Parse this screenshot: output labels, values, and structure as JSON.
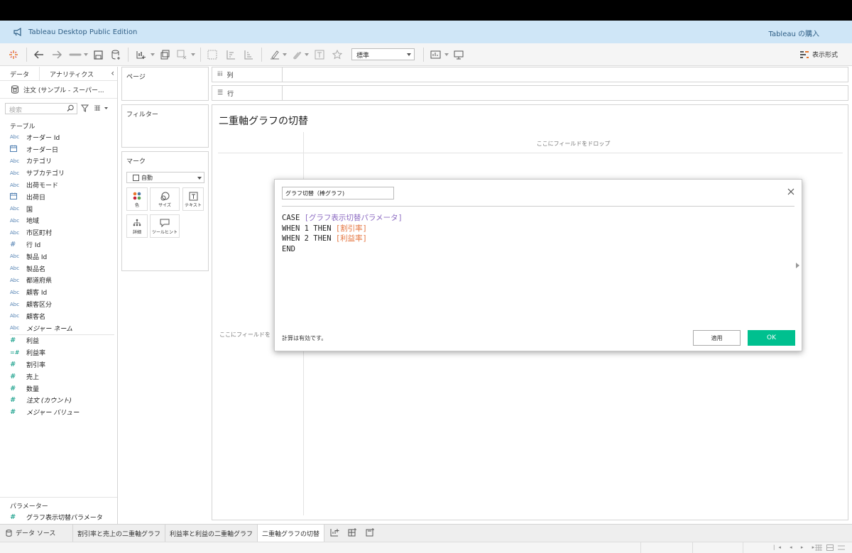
{
  "app": {
    "title": "Tableau Desktop Public Edition",
    "buy_label": "Tableau の購入"
  },
  "toolbar": {
    "fit_value": "標準",
    "show_me_label": "表示形式"
  },
  "left_panel": {
    "tab_data": "データ",
    "tab_analytics": "アナリティクス",
    "datasource": "注文 (サンプル - スーパー...",
    "search_placeholder": "検索",
    "tables_header": "テーブル",
    "dimensions": [
      {
        "type": "Abc",
        "name": "オーダー Id"
      },
      {
        "type": "date",
        "name": "オーダー日"
      },
      {
        "type": "Abc",
        "name": "カテゴリ"
      },
      {
        "type": "Abc",
        "name": "サブカテゴリ"
      },
      {
        "type": "Abc",
        "name": "出荷モード"
      },
      {
        "type": "date",
        "name": "出荷日"
      },
      {
        "type": "Abc",
        "name": "国"
      },
      {
        "type": "Abc",
        "name": "地域"
      },
      {
        "type": "Abc",
        "name": "市区町村"
      },
      {
        "type": "#",
        "name": "行 Id"
      },
      {
        "type": "Abc",
        "name": "製品 Id"
      },
      {
        "type": "Abc",
        "name": "製品名"
      },
      {
        "type": "Abc",
        "name": "都道府県"
      },
      {
        "type": "Abc",
        "name": "顧客 Id"
      },
      {
        "type": "Abc",
        "name": "顧客区分"
      },
      {
        "type": "Abc",
        "name": "顧客名"
      },
      {
        "type": "Abc",
        "name": "メジャー ネーム",
        "italic": true
      }
    ],
    "measures": [
      {
        "type": "#",
        "name": "利益"
      },
      {
        "type": "=#",
        "name": "利益率"
      },
      {
        "type": "#",
        "name": "割引率"
      },
      {
        "type": "#",
        "name": "売上"
      },
      {
        "type": "#",
        "name": "数量"
      },
      {
        "type": "#",
        "name": "注文 (カウント)",
        "italic": true
      },
      {
        "type": "#",
        "name": "メジャー バリュー",
        "italic": true
      }
    ],
    "parameters_header": "パラメーター",
    "parameters": [
      {
        "type": "#",
        "name": "グラフ表示切替パラメータ"
      }
    ]
  },
  "cards": {
    "pages": "ページ",
    "filters": "フィルター",
    "marks": "マーク",
    "mark_type": "自動",
    "mark_buttons": [
      "色",
      "サイズ",
      "テキスト",
      "詳細",
      "ツールヒント"
    ]
  },
  "shelves": {
    "columns": "列",
    "rows": "行"
  },
  "view": {
    "title": "二重軸グラフの切替",
    "drop_top": "ここにフィールドをドロップ",
    "drop_left": "ここにフィールドを"
  },
  "dialog": {
    "name": "グラフ切替（棒グラフ)",
    "code": {
      "l1_kw": "CASE ",
      "l1_param": "[グラフ表示切替パラメータ]",
      "l2_kw": "WHEN 1 THEN ",
      "l2_field": "[割引率]",
      "l3_kw": "WHEN 2 THEN ",
      "l3_field": "[利益率]",
      "l4_kw": "END"
    },
    "status": "計算は有効です。",
    "apply_label": "適用",
    "ok_label": "OK"
  },
  "bottom_tabs": {
    "datasource": "データ ソース",
    "sheets": [
      "割引率と売上の二重軸グラフ",
      "利益率と利益の二重軸グラフ",
      "二重軸グラフの切替"
    ],
    "active_index": 2
  },
  "colors": {
    "accent_ok": "#00c08f",
    "param_purple": "#8c6bc2",
    "field_orange": "#e4743e",
    "measure_green": "#00967f",
    "dimension_blue": "#4f7fb1"
  }
}
